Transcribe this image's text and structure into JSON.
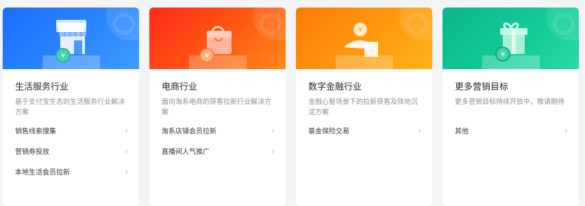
{
  "cards": [
    {
      "title": "生活服务行业",
      "desc": "基于支付宝生态的生活服务行业解决方案",
      "banner_icon": "storefront-icon",
      "items": [
        "销售线索搜集",
        "营销券投放",
        "本地生活会员拉新"
      ]
    },
    {
      "title": "电商行业",
      "desc": "面向淘系电商的获客拉新行业解决方案",
      "banner_icon": "shopping-bag-icon",
      "items": [
        "淘系店铺会员拉新",
        "直播间人气推广"
      ]
    },
    {
      "title": "数字金融行业",
      "desc": "金融心智场景下的拉新获客及阵地沉淀方案",
      "banner_icon": "hand-coin-icon",
      "items": [
        "基金保险交易"
      ]
    },
    {
      "title": "更多营销目标",
      "desc": "更多营销目标持续开放中，敬请期待",
      "banner_icon": "gift-box-icon",
      "items": [
        "其他"
      ]
    }
  ],
  "chevron_icon": "chevron-right-icon",
  "coin_symbol": "¥",
  "colors": {
    "service_banner": "#2c88ff",
    "ecommerce_banner": "#ff4a14",
    "finance_banner": "#ff9c0f",
    "more_banner": "#12cc98"
  }
}
